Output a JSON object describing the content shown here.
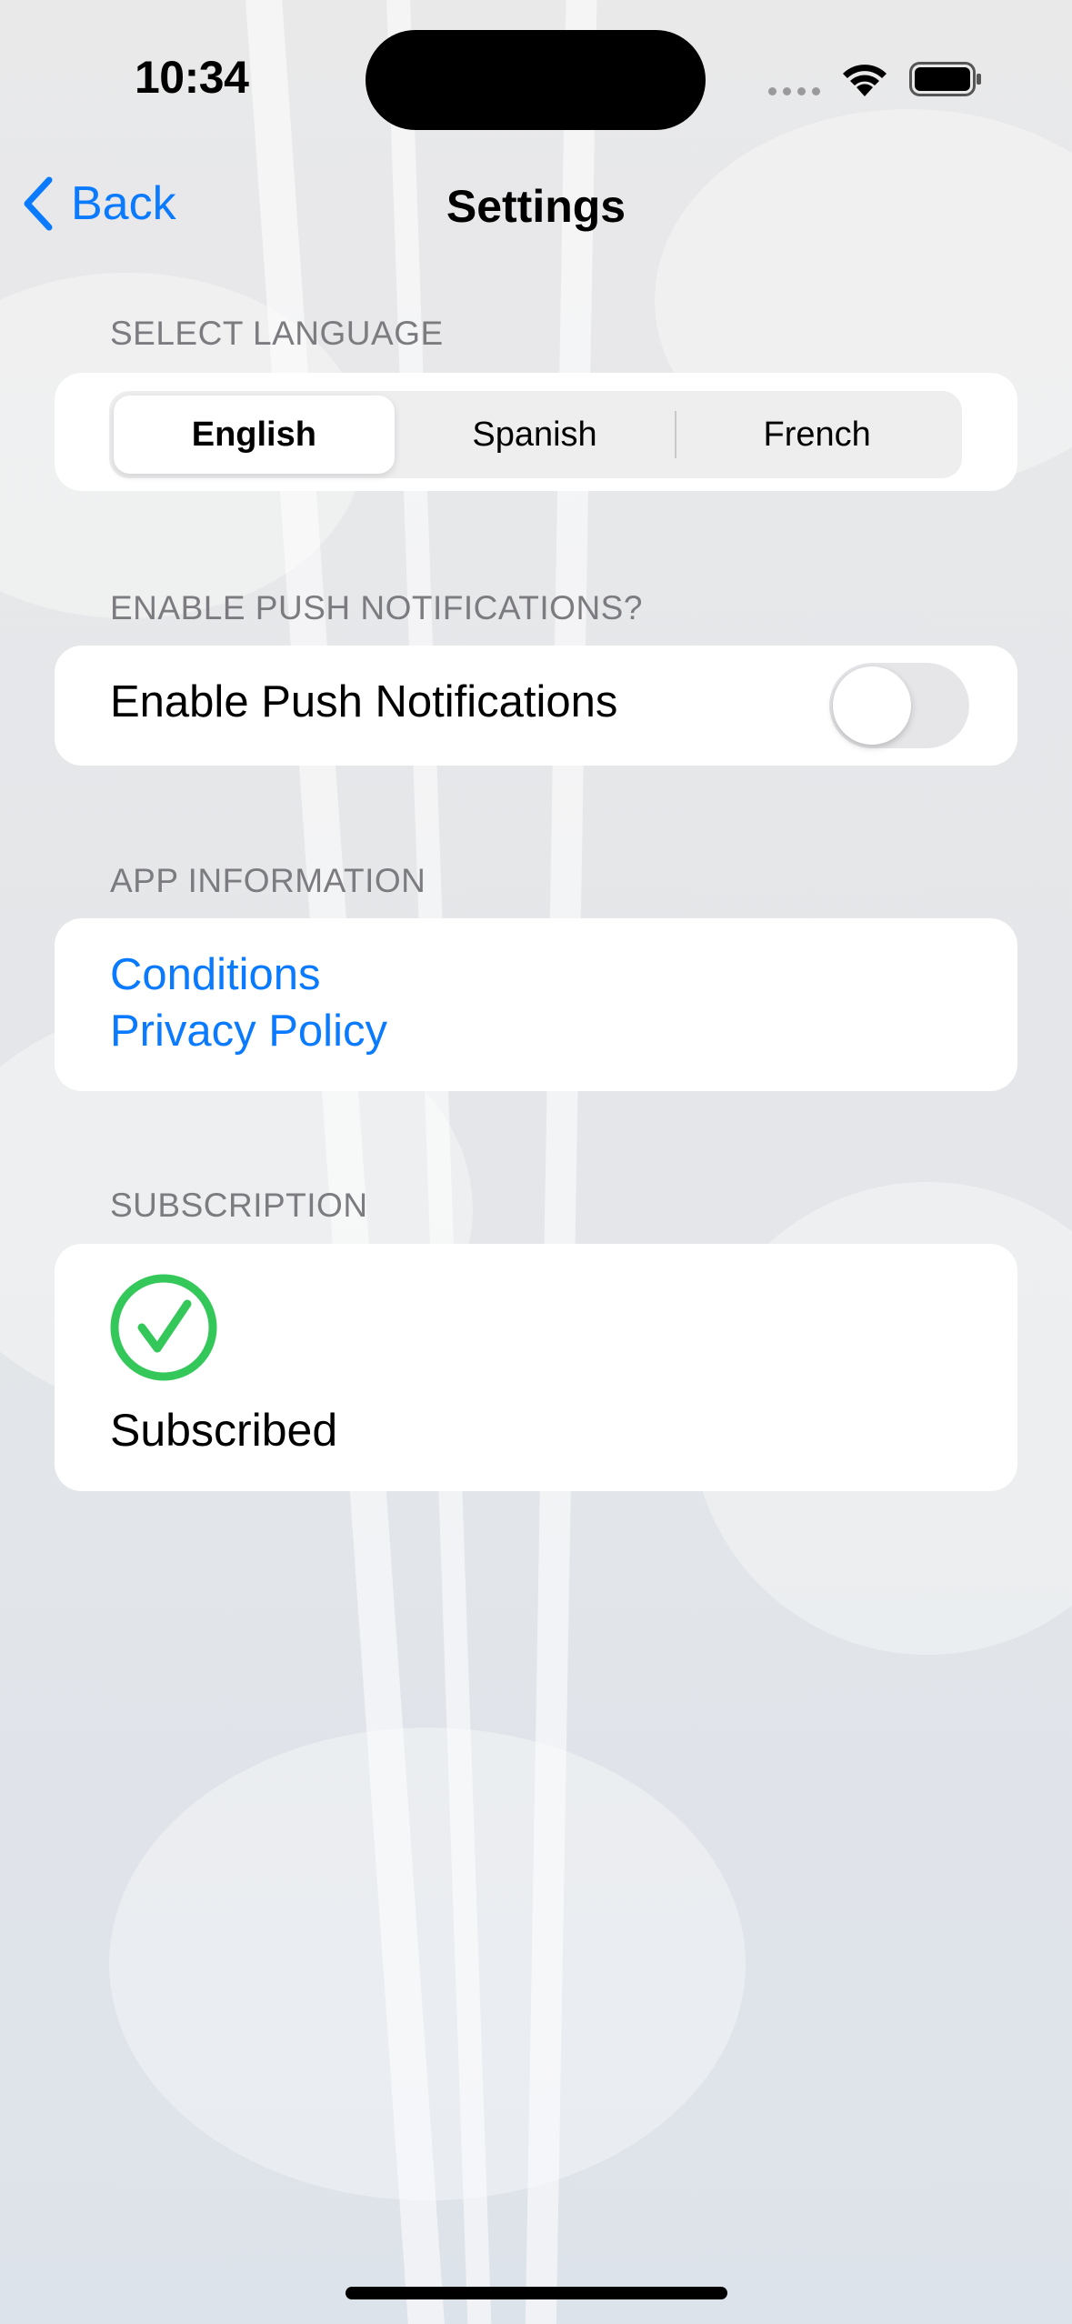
{
  "status_bar": {
    "time": "10:34"
  },
  "nav": {
    "back_label": "Back",
    "title": "Settings"
  },
  "language": {
    "header": "SELECT LANGUAGE",
    "options": [
      "English",
      "Spanish",
      "French"
    ],
    "selected": "English"
  },
  "notifications": {
    "header": "ENABLE PUSH NOTIFICATIONS?",
    "label": "Enable Push Notifications",
    "enabled": false
  },
  "app_info": {
    "header": "APP INFORMATION",
    "links": [
      "Conditions",
      "Privacy Policy"
    ]
  },
  "subscription": {
    "header": "SUBSCRIPTION",
    "status": "Subscribed"
  },
  "colors": {
    "accent": "#0a7aff",
    "check_green": "#34c759",
    "section_header": "#7c7c80"
  }
}
